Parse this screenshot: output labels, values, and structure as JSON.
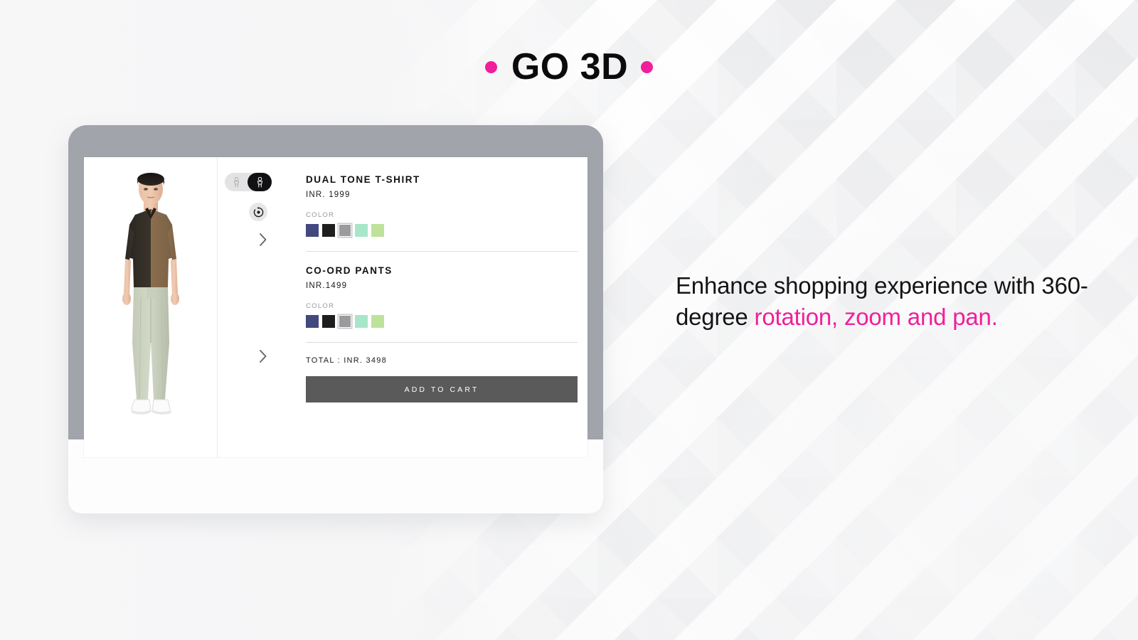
{
  "headline": {
    "text": "GO 3D",
    "dot_color": "#f01f9b",
    "left_dot": "dot",
    "right_dot": "dot"
  },
  "viewer": {
    "avatar_alt": "3d-male-avatar-wearing-dual-tone-tshirt-and-co-ord-pants",
    "toggle": {
      "left_icon": "avatar-figure-icon",
      "right_icon": "avatar-figure-icon-active",
      "active_side": "right"
    },
    "reset_icon": "rotate-reset-icon",
    "next_top_icon": "chevron-right-icon",
    "next_bottom_icon": "chevron-right-icon"
  },
  "products": [
    {
      "title": "DUAL TONE T-SHIRT",
      "price": "INR. 1999",
      "color_label": "COLOR",
      "swatches": [
        {
          "name": "navy",
          "hex": "#42497e"
        },
        {
          "name": "black",
          "hex": "#1e1e1f"
        },
        {
          "name": "grey",
          "hex": "#9b9b9e",
          "selected": true
        },
        {
          "name": "mint",
          "hex": "#a7e6c8"
        },
        {
          "name": "light-green",
          "hex": "#bde39a"
        }
      ]
    },
    {
      "title": "CO-ORD PANTS",
      "price": "INR.1499",
      "color_label": "COLOR",
      "swatches": [
        {
          "name": "navy",
          "hex": "#42497e"
        },
        {
          "name": "black",
          "hex": "#1e1e1f"
        },
        {
          "name": "grey",
          "hex": "#9b9b9e",
          "selected": true
        },
        {
          "name": "mint",
          "hex": "#a7e6c8"
        },
        {
          "name": "light-green",
          "hex": "#bde39a"
        }
      ]
    }
  ],
  "cart": {
    "total_text": "TOTAL : INR. 3498",
    "button_label": "ADD TO CART",
    "button_color": "#5a5a5a"
  },
  "promo": {
    "lead": "Enhance shopping experience with 360-degree ",
    "accent": "rotation, zoom and pan.",
    "accent_color": "#f01f9b"
  }
}
